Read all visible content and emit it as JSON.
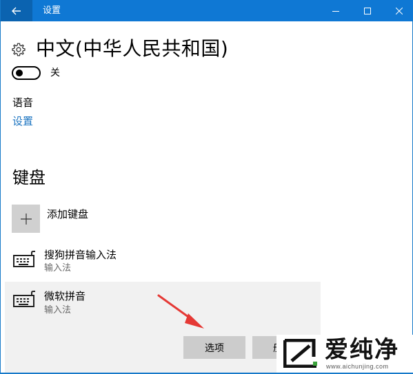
{
  "titlebar": {
    "title": "设置",
    "back_icon": "back-arrow-icon",
    "minimize_icon": "minimize-icon",
    "maximize_icon": "maximize-icon",
    "close_icon": "close-icon",
    "bg_color": "#0f78d4"
  },
  "page": {
    "icon": "gear-icon",
    "heading": "中文(中华人民共和国)"
  },
  "toggle": {
    "state": "off",
    "label": "关"
  },
  "speech": {
    "label": "语音",
    "settings_link": "设置",
    "link_color": "#1a73c0"
  },
  "keyboards": {
    "title": "键盘",
    "add_label": "添加键盘",
    "add_icon": "plus-icon",
    "items": [
      {
        "name": "搜狗拼音输入法",
        "type": "输入法",
        "icon": "keyboard-icon",
        "selected": false
      },
      {
        "name": "微软拼音",
        "type": "输入法",
        "icon": "keyboard-icon",
        "selected": true
      }
    ],
    "options_button": "选项",
    "remove_button_partial": "册"
  },
  "watermark": {
    "text": "爱纯净",
    "url": "www.aichunjing.com"
  }
}
